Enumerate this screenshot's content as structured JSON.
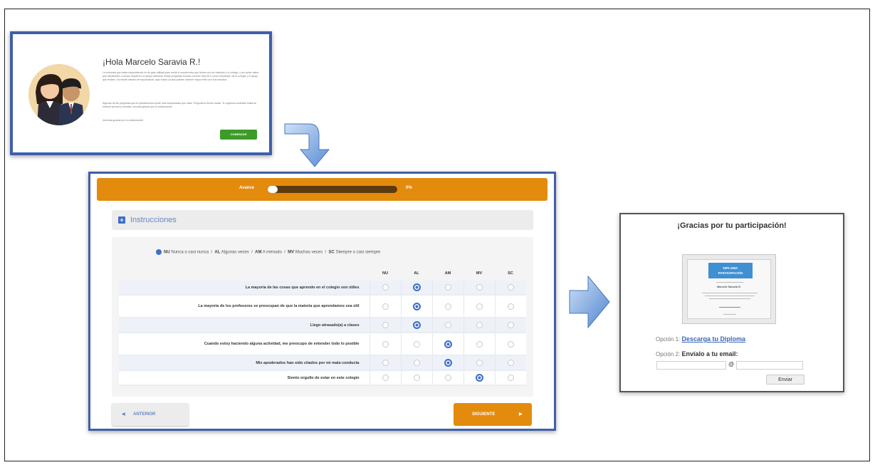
{
  "welcome": {
    "greeting": "¡Hola Marcelo Saravia R.!",
    "paragraph_1": "La encuesta que estás respondiendo es de gran utilidad para medir el compromiso que tienes con tus estudios y tu colegio, y así poder saber qué estudiantes o cursos requieren un apoyo adicional. Estas preguntas buscan conocer más de ti como estudiante, de tu colegio y el apoyo que recibes. No existe manera de equivocarse, aquí todas y todos pueden obtener mayor éxito con sus estudios.",
    "paragraph_2": "Algunas de las preguntas que te plantearemos serán más complicadas que otras. Pregunta si tienes dudas. Te rogamos contestar todas de manera sincera y honesta, muchas gracias por tu colaboración.",
    "paragraph_3": "¡Muchas gracias por tu colaboración!",
    "start_button": "COMENZAR"
  },
  "survey": {
    "progress_label": "Avance",
    "progress_value": 0,
    "progress_text": "0%",
    "instructions_label": "Instrucciones",
    "legend": [
      {
        "code": "NU",
        "text": "Nunca o casi nunca"
      },
      {
        "code": "AL",
        "text": "Algunas veces"
      },
      {
        "code": "AM",
        "text": "A menudo"
      },
      {
        "code": "MV",
        "text": "Muchas veces"
      },
      {
        "code": "SC",
        "text": "Siempre o casi siempre"
      }
    ],
    "columns": [
      "NU",
      "AL",
      "AM",
      "MV",
      "SC"
    ],
    "questions": [
      {
        "text": "La mayoría de las cosas que aprendo en el colegio son útiles",
        "selected": 1
      },
      {
        "text": "La mayoría de los profesores se preocupan de que la materia que aprendamos sea útil",
        "selected": 1
      },
      {
        "text": "Llego atrasado(a) a clases",
        "selected": 1
      },
      {
        "text": "Cuando estoy haciendo alguna actividad, me preocupo de entender todo lo posible",
        "selected": 2
      },
      {
        "text": "Mis apoderados han sido citados por mi mala conducta",
        "selected": 2
      },
      {
        "text": "Siento orgullo de estar en este colegio",
        "selected": 3
      }
    ],
    "prev_button": "ANTERIOR",
    "next_button": "SIGUIENTE"
  },
  "thanks": {
    "title": "¡Gracias por tu participación!",
    "diploma_title_1": "DIPLOMA",
    "diploma_title_2": "PARTICIPACIÓN",
    "diploma_name": "Marcelo Saravia R.",
    "option1_prefix": "Opción 1:",
    "option1_link": "Descarga tu Diploma",
    "option2_prefix": "Opción 2:",
    "option2_label": "Envíalo a tu email:",
    "at_symbol": "@",
    "send_button": "Enviar"
  },
  "colors": {
    "accent_orange": "#e38b0d",
    "accent_blue": "#3f6fc7",
    "window_border": "#3f5fa8",
    "start_green": "#3d9b27"
  }
}
